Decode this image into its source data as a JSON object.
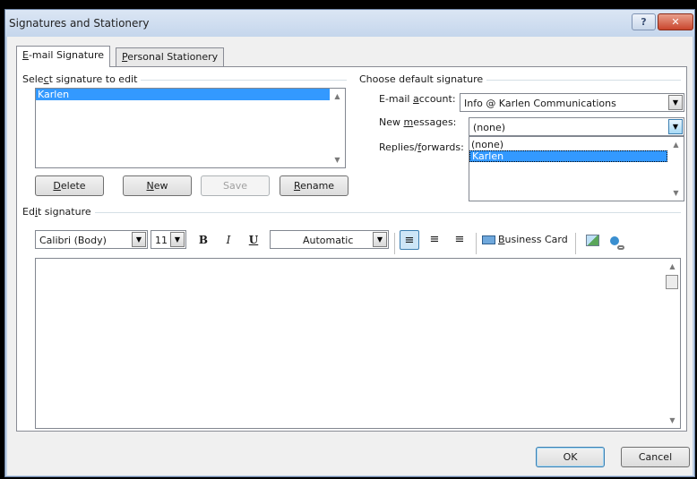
{
  "window": {
    "title": "Signatures and Stationery",
    "help_label": "?",
    "close_label": "✕"
  },
  "tabs": [
    {
      "pre": "",
      "key": "E",
      "post": "-mail Signature",
      "active": true
    },
    {
      "pre": "",
      "key": "P",
      "post": "ersonal Stationery",
      "active": false
    }
  ],
  "select_signature": {
    "label_pre": "Sele",
    "label_key": "c",
    "label_post": "t signature to edit",
    "items": [
      "Karlen"
    ],
    "selected": "Karlen"
  },
  "signature_buttons": {
    "delete": {
      "key": "D",
      "post": "elete"
    },
    "new": {
      "key": "N",
      "post": "ew"
    },
    "save": "Save",
    "rename": {
      "key": "R",
      "post": "ename"
    }
  },
  "default_signature": {
    "group_label": "Choose default signature",
    "email_account_pre": "E-mail ",
    "email_account_key": "a",
    "email_account_post": "ccount:",
    "email_account_value": "Info @ Karlen Communications",
    "new_messages_pre": "New ",
    "new_messages_key": "m",
    "new_messages_post": "essages:",
    "new_messages_value": "(none)",
    "replies_pre": "Replies/",
    "replies_key": "f",
    "replies_post": "orwards:",
    "dropdown_options": [
      "(none)",
      "Karlen"
    ],
    "dropdown_selected": "Karlen"
  },
  "edit_signature": {
    "label_pre": "Ed",
    "label_key": "i",
    "label_post": "t signature",
    "font": "Calibri (Body)",
    "size": "11",
    "bold": "B",
    "italic": "I",
    "underline": "U",
    "color": "Automatic",
    "business_card_pre": "",
    "business_card_key": "B",
    "business_card_post": "usiness Card",
    "body_text": ""
  },
  "footer": {
    "ok": "OK",
    "cancel": "Cancel"
  }
}
